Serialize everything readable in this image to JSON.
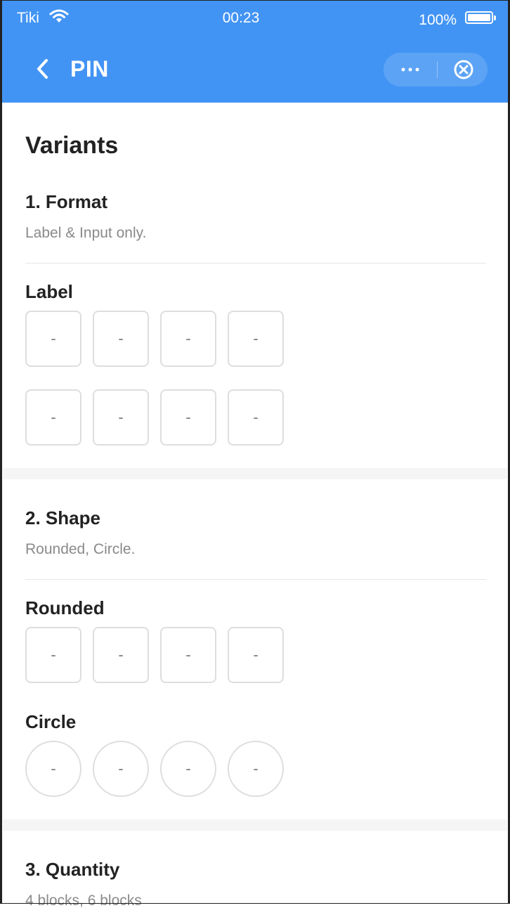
{
  "status_bar": {
    "carrier": "Tiki",
    "time": "00:23",
    "battery": "100%"
  },
  "nav": {
    "title": "PIN",
    "icons": [
      "chevron-left-icon",
      "more-icon",
      "close-circle-icon"
    ]
  },
  "page": {
    "heading": "Variants",
    "sections": [
      {
        "title": "1. Format",
        "description": "Label & Input only.",
        "groups": [
          {
            "label": "Label",
            "rows": [
              [
                "-",
                "-",
                "-",
                "-"
              ],
              [
                "-",
                "-",
                "-",
                "-"
              ]
            ]
          }
        ]
      },
      {
        "title": "2. Shape",
        "description": "Rounded, Circle.",
        "groups": [
          {
            "label": "Rounded",
            "rows": [
              [
                "-",
                "-",
                "-",
                "-"
              ]
            ]
          },
          {
            "label": "Circle",
            "rows": [
              [
                "-",
                "-",
                "-",
                "-"
              ]
            ]
          }
        ]
      },
      {
        "title": "3. Quantity",
        "description": "4 blocks, 6 blocks"
      }
    ]
  },
  "colors": {
    "header": "#4294f4",
    "pin_border": "#dedede",
    "muted_text": "#8a8a8a",
    "section_gap": "#f5f5f5"
  }
}
